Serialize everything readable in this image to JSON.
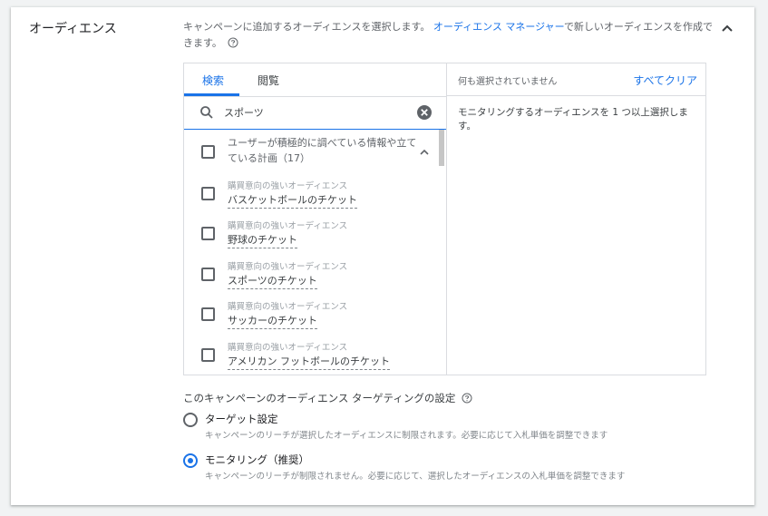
{
  "section": {
    "title": "オーディエンス",
    "description_prefix": "キャンペーンに追加するオーディエンスを選択します。",
    "manager_link": "オーディエンス マネージャー",
    "description_suffix": "で新しいオーディエンスを作成できます。"
  },
  "tabs": {
    "search": "検索",
    "browse": "閲覧"
  },
  "search": {
    "value": "スポーツ"
  },
  "group": {
    "label": "ユーザーが積極的に調べている情報や立てている計画（17）"
  },
  "items": [
    {
      "category": "購買意向の強いオーディエンス",
      "name": "バスケットボールのチケット"
    },
    {
      "category": "購買意向の強いオーディエンス",
      "name": "野球のチケット"
    },
    {
      "category": "購買意向の強いオーディエンス",
      "name": "スポーツのチケット"
    },
    {
      "category": "購買意向の強いオーディエンス",
      "name": "サッカーのチケット"
    },
    {
      "category": "購買意向の強いオーディエンス",
      "name": "アメリカン フットボールのチケット"
    }
  ],
  "selection": {
    "none_selected": "何も選択されていません",
    "clear_all": "すべてクリア",
    "hint": "モニタリングするオーディエンスを 1 つ以上選択します。"
  },
  "targeting": {
    "title": "このキャンペーンのオーディエンス ターゲティングの設定",
    "options": [
      {
        "label": "ターゲット設定",
        "description": "キャンペーンのリーチが選択したオーディエンスに制限されます。必要に応じて入札単価を調整できます",
        "selected": false
      },
      {
        "label": "モニタリング（推奨）",
        "description": "キャンペーンのリーチが制限されません。必要に応じて、選択したオーディエンスの入札単価を調整できます",
        "selected": true
      }
    ]
  },
  "colors": {
    "accent": "#1a73e8",
    "text": "#3c4043",
    "muted": "#5f6368",
    "border": "#dadce0"
  }
}
